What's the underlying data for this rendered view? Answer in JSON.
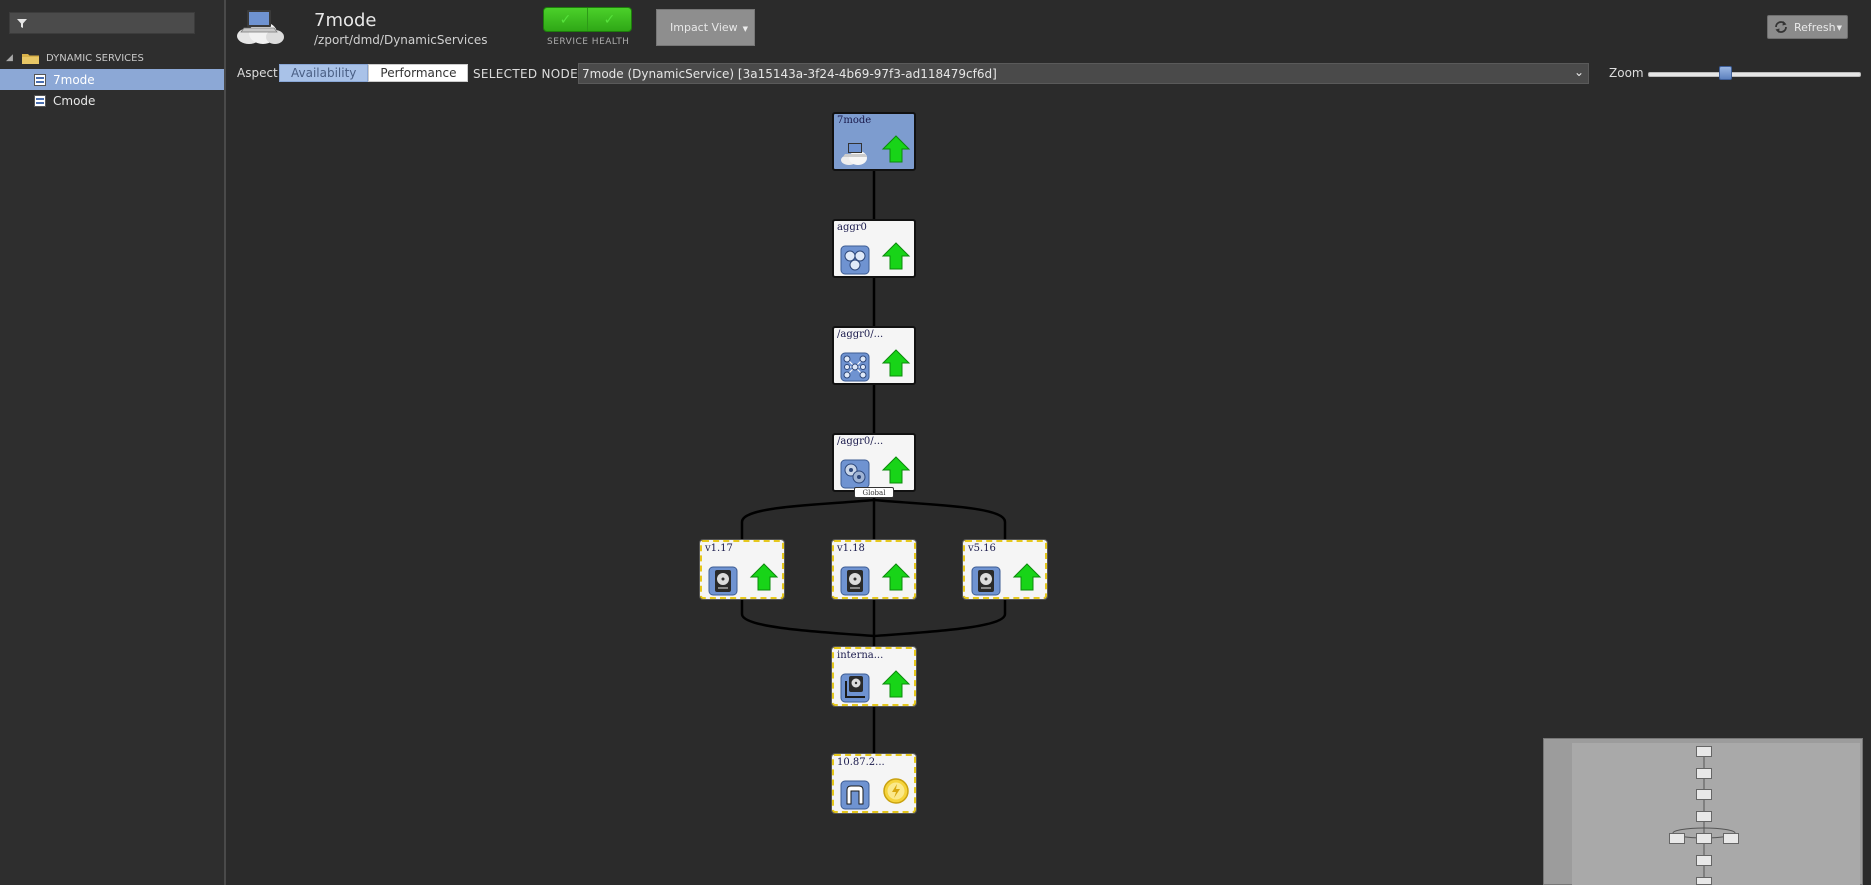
{
  "sidebar": {
    "filter_placeholder": "",
    "root_label": "DYNAMIC SERVICES",
    "items": [
      {
        "label": "7mode",
        "selected": true
      },
      {
        "label": "Cmode",
        "selected": false
      }
    ]
  },
  "header": {
    "title": "7mode",
    "path": "/zport/dmd/DynamicServices",
    "health_label": "SERVICE HEALTH",
    "health_left": "✓",
    "health_right": "✓",
    "impact_view_label": "Impact View",
    "refresh_label": "Refresh"
  },
  "toolbar": {
    "aspect_label": "Aspect",
    "aspect_options": [
      "Availability",
      "Performance"
    ],
    "aspect_selected": "Availability",
    "selected_node_label": "SELECTED NODE:",
    "selected_node_value": "7mode (DynamicService) [3a15143a-3f24-4b69-97f3-ad118479cf6d]",
    "zoom_label": "Zoom",
    "zoom_level": 0.36
  },
  "graph": {
    "nodes": [
      {
        "label": "7mode",
        "icon": "cloud-computer-icon",
        "state": "up-arrow-icon",
        "style": "root"
      },
      {
        "label": "aggr0",
        "icon": "aggregate-icon",
        "state": "up-arrow-icon",
        "style": "plain"
      },
      {
        "label": "/aggr0/...",
        "icon": "network-nodes-icon",
        "state": "up-arrow-icon",
        "style": "plain"
      },
      {
        "label": "/aggr0/...",
        "icon": "cluster-icon",
        "state": "up-arrow-icon",
        "style": "plain"
      },
      {
        "label": "v1.17",
        "icon": "disk-icon",
        "state": "up-arrow-icon",
        "style": "warn"
      },
      {
        "label": "v1.18",
        "icon": "disk-icon",
        "state": "up-arrow-icon",
        "style": "warn"
      },
      {
        "label": "v5.16",
        "icon": "disk-icon",
        "state": "up-arrow-icon",
        "style": "warn"
      },
      {
        "label": "interna...",
        "icon": "storage-controller-icon",
        "state": "up-arrow-icon",
        "style": "warn"
      },
      {
        "label": "10.87.2...",
        "icon": "network-device-icon",
        "state": "unknown-state-icon",
        "style": "warn"
      }
    ],
    "global_tag": "Global"
  },
  "colors": {
    "selected_row": "#8ca8d6",
    "root_node": "#7d9ccf",
    "health_green": "#3cbf1f",
    "warn_border": "#e6c81c"
  }
}
